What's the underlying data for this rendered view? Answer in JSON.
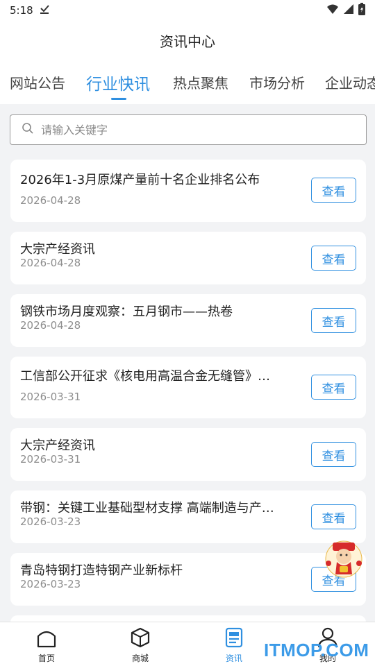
{
  "status": {
    "time": "5:18"
  },
  "header": {
    "title": "资讯中心"
  },
  "tabs": [
    {
      "label": "网站公告"
    },
    {
      "label": "行业快讯",
      "active": true
    },
    {
      "label": "热点聚焦"
    },
    {
      "label": "市场分析"
    },
    {
      "label": "企业动态"
    }
  ],
  "search": {
    "placeholder": "请输入关键字",
    "value": ""
  },
  "news": [
    {
      "title": "2026年1-3月原煤产量前十名企业排名公布",
      "date": "2026-04-28",
      "button": "查看"
    },
    {
      "title": "大宗产经资讯",
      "date": "2026-04-28",
      "button": "查看"
    },
    {
      "title": "钢铁市场月度观察：五月钢市——热卷",
      "date": "2026-04-28",
      "button": "查看"
    },
    {
      "title": "工信部公开征求《核电用高温合金无缝管》…",
      "date": "2026-03-31",
      "button": "查看"
    },
    {
      "title": "大宗产经资讯",
      "date": "2026-03-31",
      "button": "查看"
    },
    {
      "title": "带钢：关键工业基础型材支撑 高端制造与产…",
      "date": "2026-03-23",
      "button": "查看"
    },
    {
      "title": "青岛特钢打造特钢产业新标杆",
      "date": "2026-03-23",
      "button": "查看"
    }
  ],
  "bottom_nav": [
    {
      "label": "首页",
      "icon": "home-icon"
    },
    {
      "label": "商城",
      "icon": "box-icon"
    },
    {
      "label": "资讯",
      "icon": "news-icon",
      "active": true
    },
    {
      "label": "我的",
      "icon": "user-icon"
    }
  ],
  "watermark": "ITMOP.COM",
  "colors": {
    "accent": "#2f8fe0",
    "background": "#f2f3f5"
  }
}
